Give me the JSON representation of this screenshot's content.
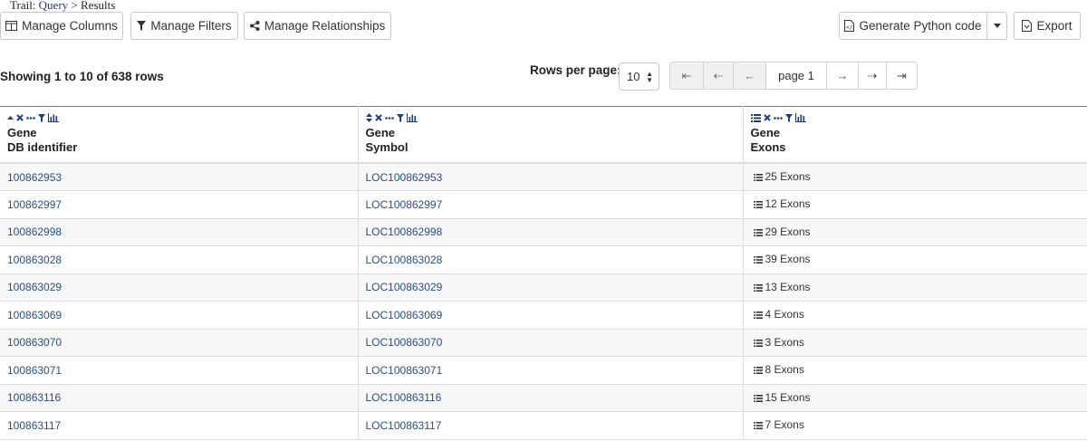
{
  "breadcrumb": {
    "prefix": "Trail:",
    "link": "Query",
    "separator": ">",
    "current": "Results"
  },
  "toolbar": {
    "manage_columns": "Manage Columns",
    "manage_filters": "Manage Filters",
    "manage_relationships": "Manage Relationships",
    "generate_code": "Generate Python code",
    "export": "Export"
  },
  "summary": "Showing 1 to 10 of 638 rows",
  "rows_per_page": {
    "label": "Rows per page:",
    "value": "10"
  },
  "pager": {
    "first": "⇤",
    "prev_fast": "⇠",
    "prev": "←",
    "page": "page 1",
    "next": "→",
    "next_fast": "⇢",
    "last": "⇥"
  },
  "columns": [
    {
      "class": "Gene",
      "field": "DB identifier",
      "sort_icon": "sort-up-icon"
    },
    {
      "class": "Gene",
      "field": "Symbol",
      "sort_icon": "sort-both-icon"
    },
    {
      "class": "Gene",
      "field": "Exons",
      "sort_icon": "list-icon"
    }
  ],
  "rows": [
    {
      "id": "100862953",
      "symbol": "LOC100862953",
      "exons": "25 Exons"
    },
    {
      "id": "100862997",
      "symbol": "LOC100862997",
      "exons": "12 Exons"
    },
    {
      "id": "100862998",
      "symbol": "LOC100862998",
      "exons": "29 Exons"
    },
    {
      "id": "100863028",
      "symbol": "LOC100863028",
      "exons": "39 Exons"
    },
    {
      "id": "100863029",
      "symbol": "LOC100863029",
      "exons": "13 Exons"
    },
    {
      "id": "100863069",
      "symbol": "LOC100863069",
      "exons": "4 Exons"
    },
    {
      "id": "100863070",
      "symbol": "LOC100863070",
      "exons": "3 Exons"
    },
    {
      "id": "100863071",
      "symbol": "LOC100863071",
      "exons": "8 Exons"
    },
    {
      "id": "100863116",
      "symbol": "LOC100863116",
      "exons": "15 Exons"
    },
    {
      "id": "100863117",
      "symbol": "LOC100863117",
      "exons": "7 Exons"
    }
  ],
  "colors": {
    "link": "#2a4d87",
    "header_icon": "#1f3d7a",
    "stripe": "#f7f7f7",
    "border": "#dddddd"
  }
}
